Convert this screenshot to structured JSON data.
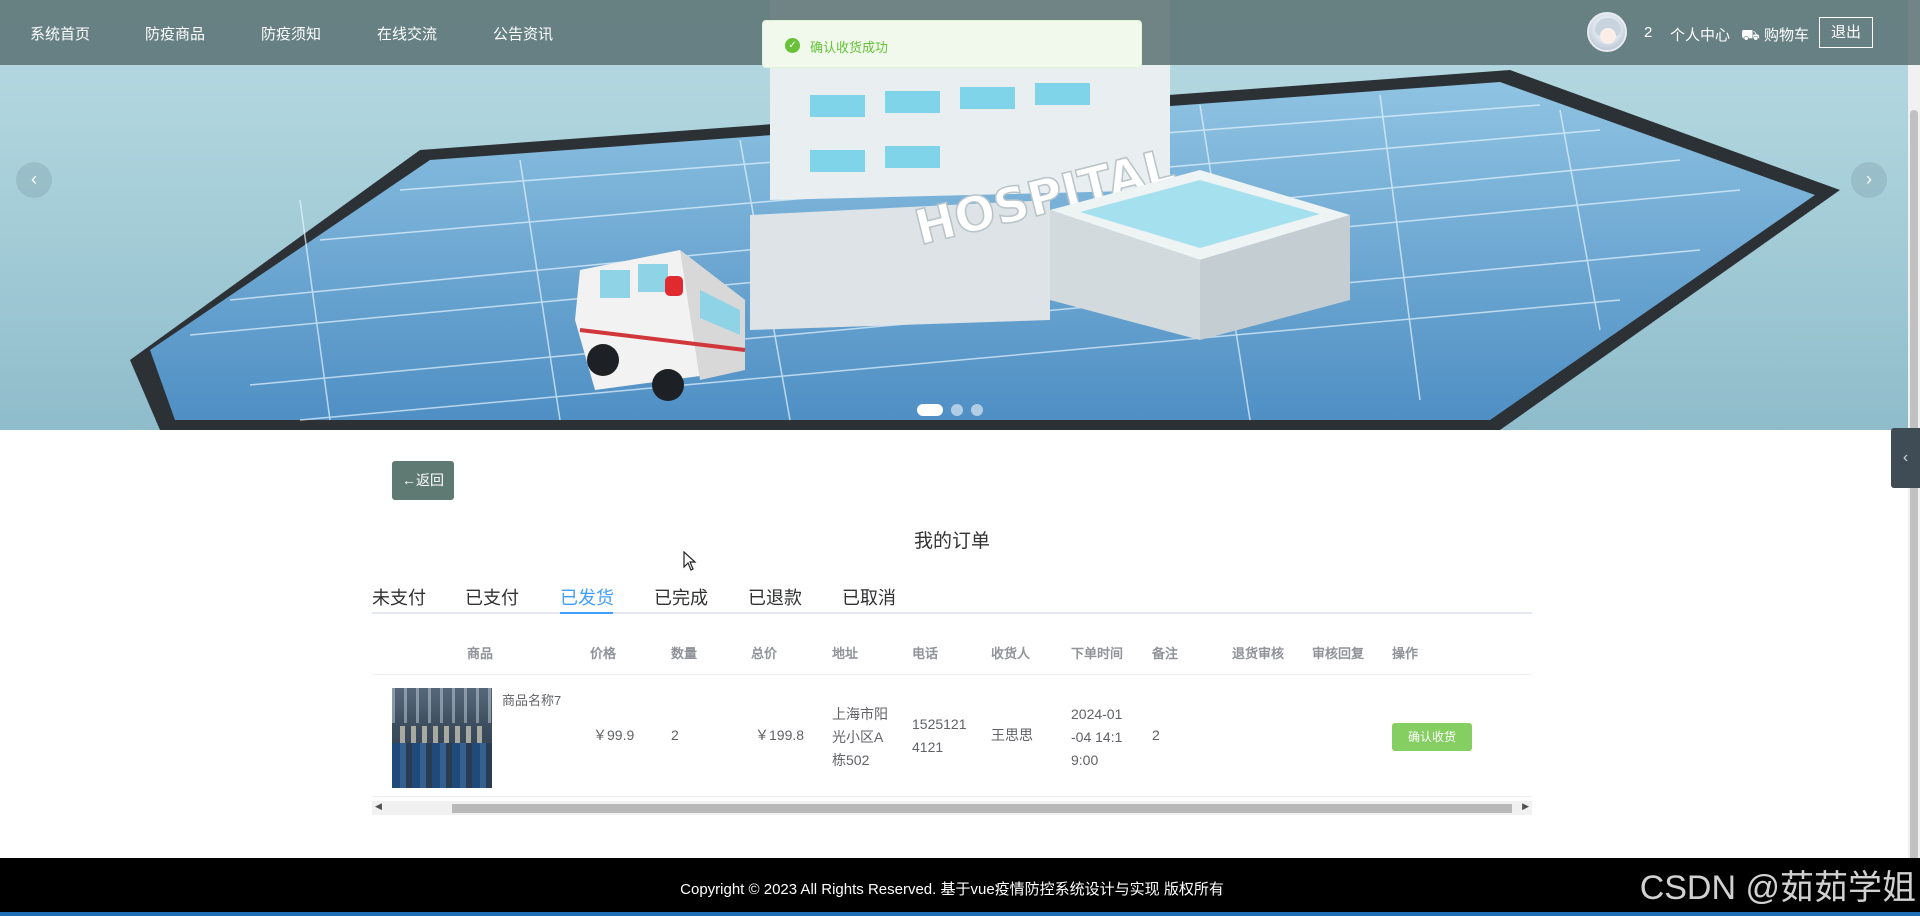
{
  "nav": {
    "items": [
      "系统首页",
      "防疫商品",
      "防疫须知",
      "在线交流",
      "公告资讯"
    ],
    "cart_count": "2",
    "user_center": "个人中心",
    "cart": "⛟ 购物车",
    "logout": "退出"
  },
  "toast": {
    "message": "确认收货成功"
  },
  "banner": {
    "sign_text": "HOSPITAL",
    "prev": "‹",
    "next": "›",
    "slides": 3,
    "active_slide": 1
  },
  "side_handle": "‹",
  "content": {
    "back_label": "←返回",
    "title": "我的订单",
    "tabs": [
      "未支付",
      "已支付",
      "已发货",
      "已完成",
      "已退款",
      "已取消"
    ],
    "active_tab": "已发货",
    "columns": [
      "商品",
      "价格",
      "数量",
      "总价",
      "地址",
      "电话",
      "收货人",
      "下单时间",
      "备注",
      "退货审核",
      "审核回复",
      "操作"
    ],
    "rows": [
      {
        "product": "商品名称7",
        "price": "￥99.9",
        "quantity": "2",
        "total": "￥199.8",
        "address_l1": "上海市阳",
        "address_l2": "光小区A",
        "address_l3": "栋502",
        "phone_l1": "1525121",
        "phone_l2": "4121",
        "receiver": "王思思",
        "time_l1": "2024-01",
        "time_l2": "-04 14:1",
        "time_l3": "9:00",
        "remark": "2",
        "return_review": "",
        "review_reply": "",
        "action": "确认收货"
      }
    ]
  },
  "footer": {
    "copyright": "Copyright © 2023 All Rights Reserved. 基于vue疫情防控系统设计与实现 版权所有",
    "watermark": "CSDN @茹茹学姐"
  }
}
